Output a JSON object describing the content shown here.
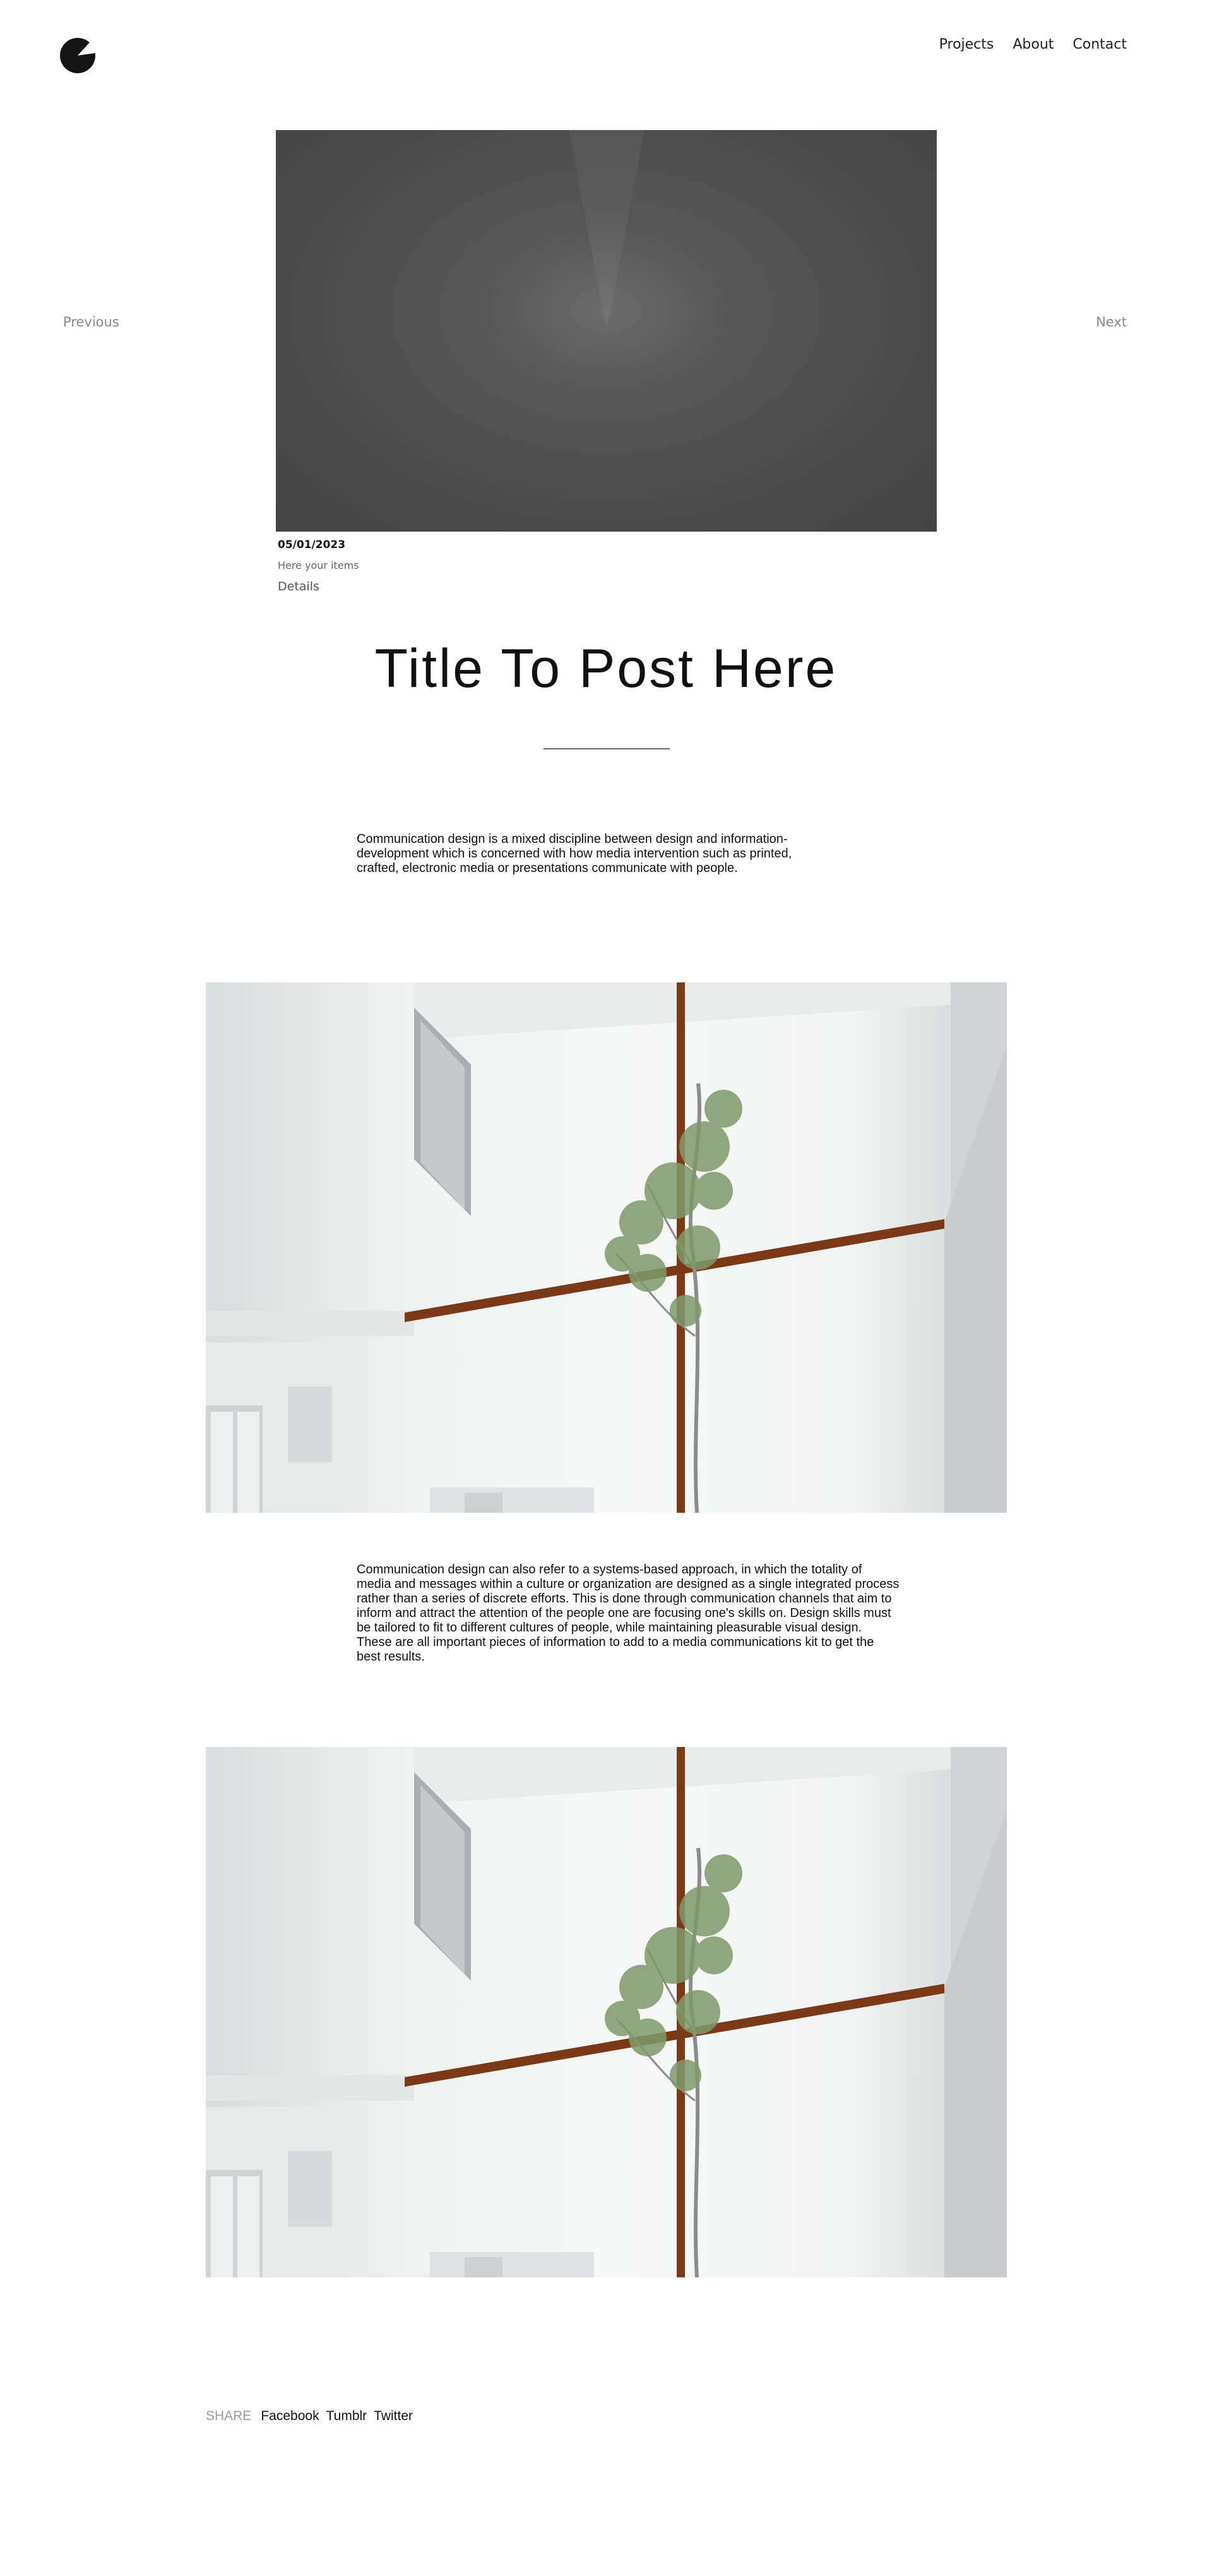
{
  "header": {
    "logo_icon": "half-circle-logo-icon",
    "nav": [
      {
        "label": "Projects"
      },
      {
        "label": "About"
      },
      {
        "label": "Contact"
      }
    ]
  },
  "pager": {
    "previous": "Previous",
    "next": "Next"
  },
  "post": {
    "date": "05/01/2023",
    "items": "Here your items",
    "details": "Details",
    "title": "Title To Post Here",
    "paragraph1": "Communication design is a mixed discipline between design and information-development which is concerned with how media intervention such as printed, crafted, electronic media or presentations communicate with people.",
    "paragraph2": "Communication design can also refer to a systems-based approach, in which the totality of media and messages within a culture or organization are designed as a single integrated process rather than a series of discrete efforts. This is done through communication channels that aim to inform and attract the attention of the people one are focusing one's skills on. Design skills must be tailored to fit to different cultures of people, while maintaining pleasurable visual design. These are all important pieces of information to add to a media communications kit to get the best results."
  },
  "share": {
    "label": "SHARE",
    "links": [
      {
        "label": "Facebook"
      },
      {
        "label": "Tumblr"
      },
      {
        "label": "Twitter"
      }
    ]
  },
  "colors": {
    "wood_beam": "#7a3a18",
    "foliage": "#7f9a6a"
  }
}
